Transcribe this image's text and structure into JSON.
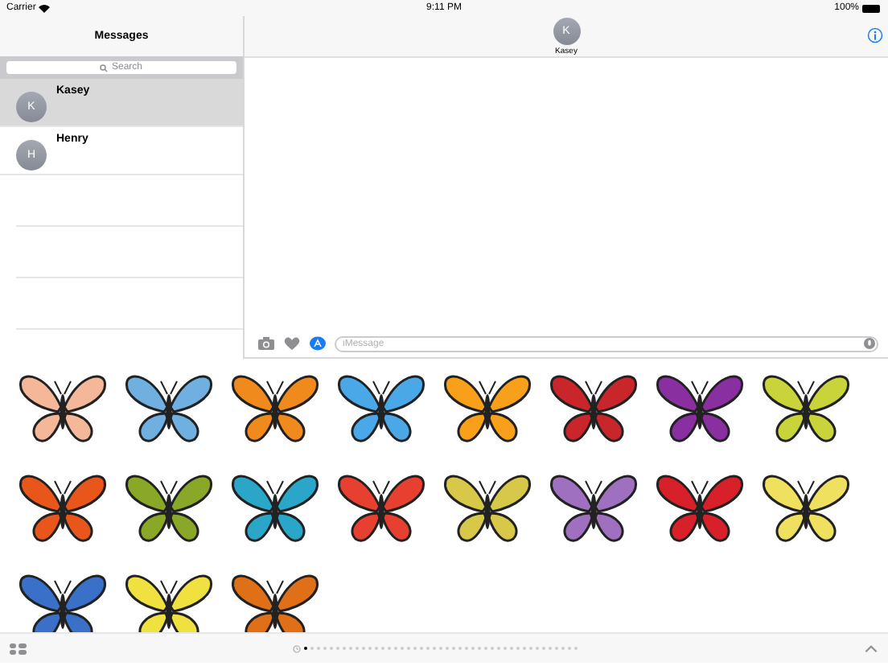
{
  "status_bar": {
    "carrier": "Carrier",
    "time": "9:11 PM",
    "battery": "100%"
  },
  "sidebar": {
    "title": "Messages",
    "search": {
      "placeholder": "Search"
    },
    "conversations": [
      {
        "initial": "K",
        "name": "Kasey",
        "selected": true
      },
      {
        "initial": "H",
        "name": "Henry",
        "selected": false
      }
    ]
  },
  "chat": {
    "contact": {
      "initial": "K",
      "name": "Kasey"
    },
    "input": {
      "placeholder": "iMessage"
    }
  },
  "stickers": [
    {
      "color": "#f4b79a"
    },
    {
      "color": "#6fb0e0"
    },
    {
      "color": "#f08a1c"
    },
    {
      "color": "#4aa8e8"
    },
    {
      "color": "#f9a01b"
    },
    {
      "color": "#c8262a"
    },
    {
      "color": "#8a2fa0"
    },
    {
      "color": "#c8d43a"
    },
    {
      "color": "#e8561c"
    },
    {
      "color": "#8aa828"
    },
    {
      "color": "#2aa6c8"
    },
    {
      "color": "#e84030"
    },
    {
      "color": "#d8c84a"
    },
    {
      "color": "#a070c0"
    },
    {
      "color": "#d8202a"
    },
    {
      "color": "#f0e060"
    },
    {
      "color": "#3a70c8"
    },
    {
      "color": "#f0e040"
    },
    {
      "color": "#e07018"
    }
  ],
  "page_dots": [
    {
      "selected": true
    },
    {
      "selected": false
    },
    {
      "selected": false
    },
    {
      "selected": false
    },
    {
      "selected": false
    },
    {
      "selected": false
    },
    {
      "selected": false
    },
    {
      "selected": false
    },
    {
      "selected": false
    },
    {
      "selected": false
    },
    {
      "selected": false
    },
    {
      "selected": false
    },
    {
      "selected": false
    },
    {
      "selected": false
    },
    {
      "selected": false
    },
    {
      "selected": false
    },
    {
      "selected": false
    },
    {
      "selected": false
    },
    {
      "selected": false
    },
    {
      "selected": false
    },
    {
      "selected": false
    },
    {
      "selected": false
    },
    {
      "selected": false
    },
    {
      "selected": false
    },
    {
      "selected": false
    },
    {
      "selected": false
    },
    {
      "selected": false
    },
    {
      "selected": false
    },
    {
      "selected": false
    },
    {
      "selected": false
    },
    {
      "selected": false
    },
    {
      "selected": false
    },
    {
      "selected": false
    },
    {
      "selected": false
    },
    {
      "selected": false
    },
    {
      "selected": false
    },
    {
      "selected": false
    },
    {
      "selected": false
    },
    {
      "selected": false
    },
    {
      "selected": false
    },
    {
      "selected": false
    },
    {
      "selected": false
    },
    {
      "selected": false
    }
  ]
}
